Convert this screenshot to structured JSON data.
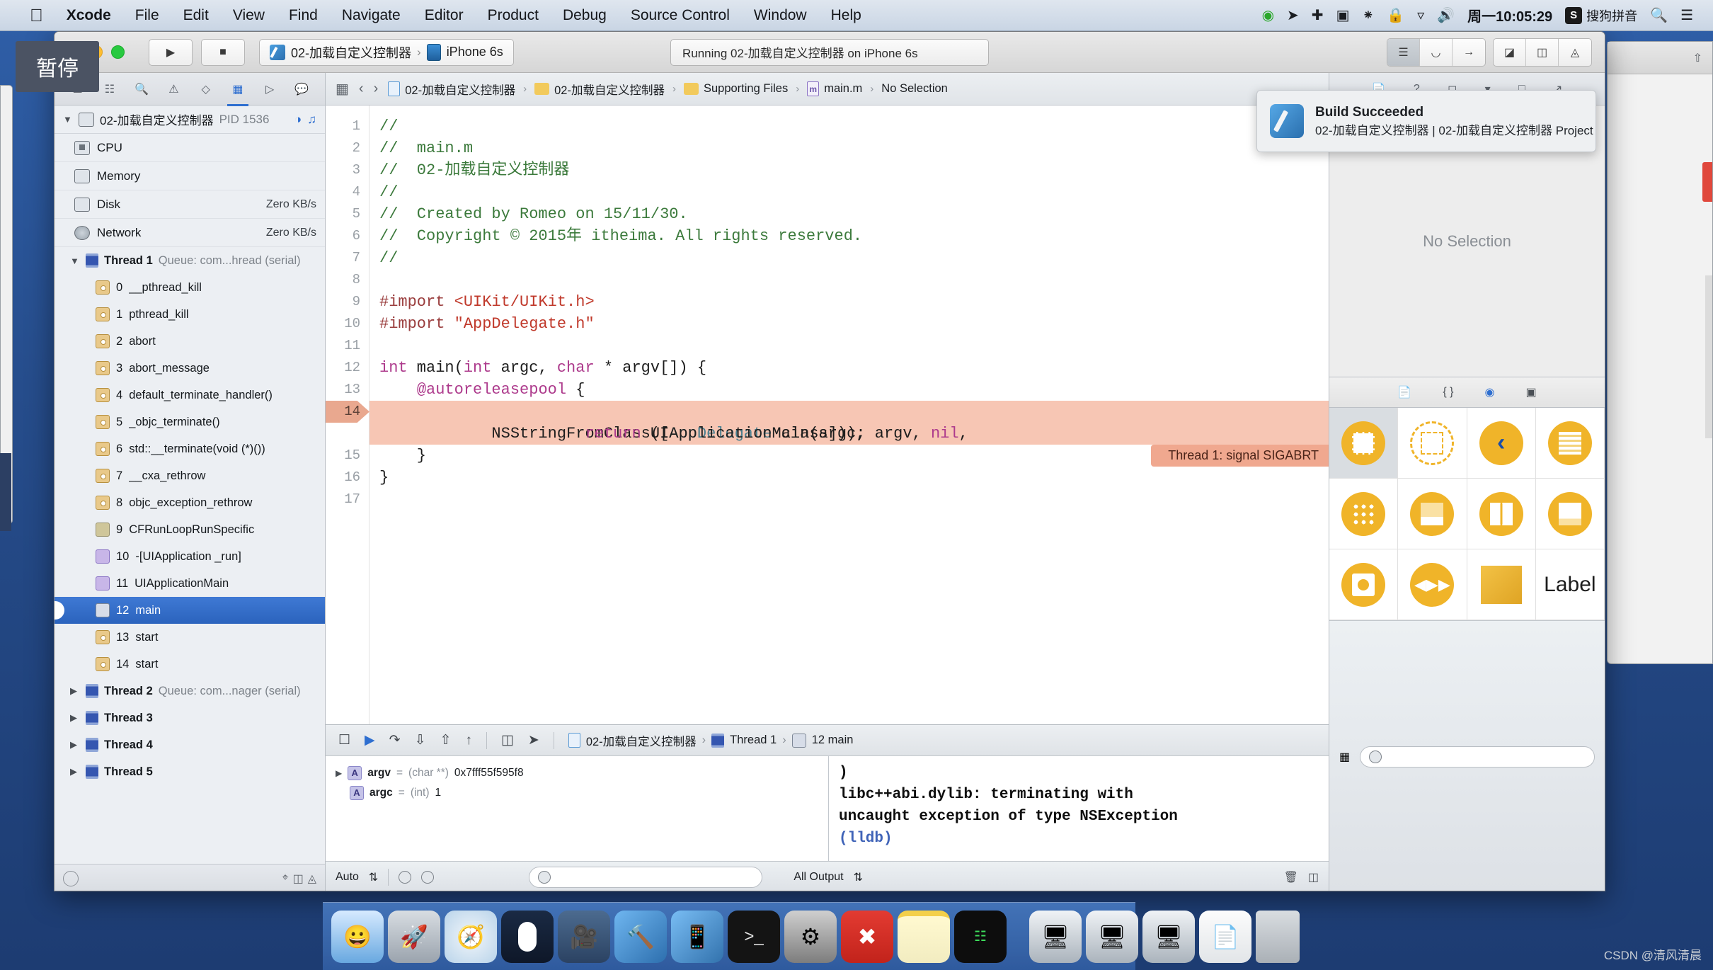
{
  "menubar": {
    "apple_icon": "apple-logo",
    "items": [
      "Xcode",
      "File",
      "Edit",
      "View",
      "Find",
      "Navigate",
      "Editor",
      "Product",
      "Debug",
      "Source Control",
      "Window",
      "Help"
    ],
    "status": {
      "clock": "周一10:05:29",
      "ime_badge": "S",
      "ime_label": "搜狗拼音",
      "icons": [
        "record-icon",
        "location-icon",
        "airplay-icon",
        "screencast-icon",
        "bluetooth-icon",
        "lock-icon",
        "wifi-icon",
        "volume-icon",
        "search-icon",
        "notification-center-icon"
      ]
    }
  },
  "tooltip": {
    "text": "暂停"
  },
  "notification": {
    "title": "Build Succeeded",
    "subtitle": "02-加载自定义控制器 | 02-加载自定义控制器 Project",
    "icon": "xcode-icon"
  },
  "toolbar": {
    "run_icon": "play-icon",
    "stop_icon": "stop-icon",
    "scheme_name": "02-加载自定义控制器",
    "scheme_separator": "›",
    "destination": "iPhone 6s",
    "status_text": "Running 02-加载自定义控制器 on iPhone 6s",
    "right_segments": [
      "editor-standard-icon",
      "editor-assistant-icon",
      "editor-version-icon"
    ],
    "view_segments": [
      "navigator-toggle-icon",
      "debug-toggle-icon",
      "utilities-toggle-icon"
    ]
  },
  "navigator": {
    "tabs": [
      "project-navigator-icon",
      "symbol-navigator-icon",
      "find-navigator-icon",
      "issue-navigator-icon",
      "test-navigator-icon",
      "debug-navigator-icon",
      "breakpoint-navigator-icon",
      "report-navigator-icon"
    ],
    "active_tab_index": 5,
    "process": {
      "name": "02-加载自定义控制器",
      "pid": "PID 1536"
    },
    "gauges": [
      {
        "name": "CPU",
        "value": "",
        "icon": "cpu-icon"
      },
      {
        "name": "Memory",
        "value": "",
        "icon": "memory-icon"
      },
      {
        "name": "Disk",
        "value": "Zero KB/s",
        "icon": "disk-icon"
      },
      {
        "name": "Network",
        "value": "Zero KB/s",
        "icon": "network-icon"
      }
    ],
    "thread1": {
      "label": "Thread 1",
      "queue": "Queue: com...hread (serial)"
    },
    "frames": [
      {
        "index": "0",
        "name": "__pthread_kill",
        "kind": "c"
      },
      {
        "index": "1",
        "name": "pthread_kill",
        "kind": "c"
      },
      {
        "index": "2",
        "name": "abort",
        "kind": "c"
      },
      {
        "index": "3",
        "name": "abort_message",
        "kind": "c"
      },
      {
        "index": "4",
        "name": "default_terminate_handler()",
        "kind": "c"
      },
      {
        "index": "5",
        "name": "_objc_terminate()",
        "kind": "c"
      },
      {
        "index": "6",
        "name": "std::__terminate(void (*)())",
        "kind": "c"
      },
      {
        "index": "7",
        "name": "__cxa_rethrow",
        "kind": "c"
      },
      {
        "index": "8",
        "name": "objc_exception_rethrow",
        "kind": "c"
      },
      {
        "index": "9",
        "name": "CFRunLoopRunSpecific",
        "kind": "cf"
      },
      {
        "index": "10",
        "name": "-[UIApplication _run]",
        "kind": "ui"
      },
      {
        "index": "11",
        "name": "UIApplicationMain",
        "kind": "ui"
      },
      {
        "index": "12",
        "name": "main",
        "kind": "m",
        "selected": true
      },
      {
        "index": "13",
        "name": "start",
        "kind": "c"
      },
      {
        "index": "14",
        "name": "start",
        "kind": "c"
      }
    ],
    "other_threads": [
      {
        "label": "Thread 2",
        "queue": "Queue: com...nager (serial)"
      },
      {
        "label": "Thread 3",
        "queue": ""
      },
      {
        "label": "Thread 4",
        "queue": ""
      },
      {
        "label": "Thread 5",
        "queue": ""
      }
    ]
  },
  "jumpbar": {
    "back_icon": "chevron-left-icon",
    "forward_icon": "chevron-right-icon",
    "crumbs": [
      "02-加载自定义控制器",
      "02-加载自定义控制器",
      "Supporting Files",
      "main.m",
      "No Selection"
    ]
  },
  "editor": {
    "file": "main.m",
    "line_numbers": [
      "1",
      "2",
      "3",
      "4",
      "5",
      "6",
      "7",
      "8",
      "9",
      "10",
      "11",
      "12",
      "13",
      "14",
      "15",
      "16",
      "17"
    ],
    "lines": [
      {
        "n": "1",
        "segs": [
          {
            "t": "//",
            "c": "cmt"
          }
        ]
      },
      {
        "n": "2",
        "segs": [
          {
            "t": "//  main.m",
            "c": "cmt"
          }
        ]
      },
      {
        "n": "3",
        "segs": [
          {
            "t": "//  02-加载自定义控制器",
            "c": "cmt"
          }
        ]
      },
      {
        "n": "4",
        "segs": [
          {
            "t": "//",
            "c": "cmt"
          }
        ]
      },
      {
        "n": "5",
        "segs": [
          {
            "t": "//  Created by Romeo on 15/11/30.",
            "c": "cmt"
          }
        ]
      },
      {
        "n": "6",
        "segs": [
          {
            "t": "//  Copyright © 2015年 itheima. All rights reserved.",
            "c": "cmt"
          }
        ]
      },
      {
        "n": "7",
        "segs": [
          {
            "t": "//",
            "c": "cmt"
          }
        ]
      },
      {
        "n": "8",
        "segs": [
          {
            "t": "",
            "c": "pln"
          }
        ]
      },
      {
        "n": "9",
        "segs": [
          {
            "t": "#import ",
            "c": "pre"
          },
          {
            "t": "<UIKit/UIKit.h>",
            "c": "str"
          }
        ]
      },
      {
        "n": "10",
        "segs": [
          {
            "t": "#import ",
            "c": "pre"
          },
          {
            "t": "\"AppDelegate.h\"",
            "c": "str"
          }
        ]
      },
      {
        "n": "11",
        "segs": [
          {
            "t": "",
            "c": "pln"
          }
        ]
      },
      {
        "n": "12",
        "segs": [
          {
            "t": "int",
            "c": "kw"
          },
          {
            "t": " main(",
            "c": "pln"
          },
          {
            "t": "int",
            "c": "kw"
          },
          {
            "t": " argc, ",
            "c": "pln"
          },
          {
            "t": "char",
            "c": "kw"
          },
          {
            "t": " * argv[]) {",
            "c": "pln"
          }
        ]
      },
      {
        "n": "13",
        "segs": [
          {
            "t": "    ",
            "c": "pln"
          },
          {
            "t": "@autoreleasepool",
            "c": "kw"
          },
          {
            "t": " {",
            "c": "pln"
          }
        ]
      },
      {
        "n": "14",
        "segs": [
          {
            "t": "        ",
            "c": "pln"
          },
          {
            "t": "return",
            "c": "kw"
          },
          {
            "t": " UIApplicationMain(argc, argv, ",
            "c": "pln"
          },
          {
            "t": "nil",
            "c": "kw"
          },
          {
            "t": ",",
            "c": "pln"
          }
        ],
        "highlight": true,
        "breakpoint": true
      },
      {
        "n": "",
        "segs": [
          {
            "t": "            NSStringFromClass([",
            "c": "pln"
          },
          {
            "t": "AppDelegate",
            "c": "cls"
          },
          {
            "t": " class]));",
            "c": "pln"
          }
        ],
        "highlight": true
      },
      {
        "n": "15",
        "segs": [
          {
            "t": "    }",
            "c": "pln"
          }
        ]
      },
      {
        "n": "16",
        "segs": [
          {
            "t": "}",
            "c": "pln"
          }
        ]
      },
      {
        "n": "17",
        "segs": [
          {
            "t": "",
            "c": "pln"
          }
        ]
      }
    ],
    "annotation": "Thread 1: signal SIGABRT"
  },
  "debug": {
    "bar_icons": [
      "hide-debug-icon",
      "continue-icon",
      "step-over-icon",
      "step-into-icon",
      "step-out-icon",
      "debug-view-hierarchy-icon",
      "simulate-location-icon"
    ],
    "crumbs": [
      "02-加载自定义控制器",
      "Thread 1",
      "12 main"
    ],
    "variables": [
      {
        "name": "argv",
        "eq": "=",
        "type": "(char **)",
        "value": "0x7fff55f595f8",
        "expandable": true
      },
      {
        "name": "argc",
        "eq": "=",
        "type": "(int)",
        "value": "1",
        "expandable": false
      }
    ],
    "console": [
      {
        "text": ")",
        "style": "plain"
      },
      {
        "text": "libc++abi.dylib: terminating with",
        "style": "plain"
      },
      {
        "text": "uncaught exception of type NSException",
        "style": "plain"
      },
      {
        "text": "(lldb)",
        "style": "lldb"
      }
    ],
    "footer": {
      "scope_label": "Auto",
      "scope_chevron": "⇅",
      "filter_placeholder": "",
      "output_label": "All Output",
      "output_chevron": "⇅",
      "trash_icon": "trash-icon",
      "split_icon": "split-panes-icon"
    }
  },
  "inspector": {
    "tabs": [
      "file-inspector-icon",
      "quick-help-icon",
      "identity-inspector-icon",
      "attributes-inspector-icon",
      "size-inspector-icon",
      "connections-inspector-icon"
    ],
    "body_text": "No Selection",
    "library_tabs": [
      "file-template-library-icon",
      "code-snippet-library-icon",
      "object-library-icon",
      "media-library-icon"
    ],
    "active_library_index": 2,
    "objects": [
      {
        "name": "view-object",
        "selected": true
      },
      {
        "name": "view-controller-object",
        "selected": false
      },
      {
        "name": "navigation-controller-object",
        "selected": false
      },
      {
        "name": "table-view-controller-object",
        "selected": false
      },
      {
        "name": "collection-view-controller-object",
        "selected": false
      },
      {
        "name": "tab-bar-controller-object",
        "selected": false
      },
      {
        "name": "split-view-controller-object",
        "selected": false
      },
      {
        "name": "page-view-controller-object",
        "selected": false
      },
      {
        "name": "glkit-view-controller-object",
        "selected": false
      },
      {
        "name": "avkit-player-controller-object",
        "selected": false
      },
      {
        "name": "object-cube",
        "selected": false
      },
      {
        "name": "label-object",
        "selected": false,
        "label": "Label"
      }
    ],
    "search_placeholder": ""
  },
  "dock": {
    "items": [
      {
        "name": "finder",
        "icon": "finder-icon",
        "running": true
      },
      {
        "name": "launchpad",
        "icon": "launchpad-icon",
        "running": false
      },
      {
        "name": "safari",
        "icon": "safari-icon",
        "running": false
      },
      {
        "name": "sogou-input",
        "icon": "sogou-icon",
        "running": true
      },
      {
        "name": "quicktime",
        "icon": "quicktime-icon",
        "running": true
      },
      {
        "name": "xcode",
        "icon": "xcode-icon",
        "running": true
      },
      {
        "name": "simulator",
        "icon": "simulator-icon",
        "running": true
      },
      {
        "name": "terminal",
        "icon": "terminal-icon",
        "running": false
      },
      {
        "name": "system-preferences",
        "icon": "gear-icon",
        "running": false
      },
      {
        "name": "xmind",
        "icon": "xmind-icon",
        "running": true
      },
      {
        "name": "notes",
        "icon": "notes-icon",
        "running": true
      },
      {
        "name": "secure-crt",
        "icon": "terminal-green-icon",
        "running": true
      }
    ],
    "minimized": [
      {
        "name": "minimized-window-1",
        "icon": "window-icon"
      },
      {
        "name": "minimized-window-2",
        "icon": "window-icon"
      },
      {
        "name": "minimized-window-3",
        "icon": "window-icon"
      },
      {
        "name": "minimized-document",
        "icon": "document-icon"
      }
    ],
    "trash": {
      "name": "trash",
      "icon": "trash-icon"
    }
  },
  "watermark": {
    "text": "CSDN @清风清晨"
  }
}
